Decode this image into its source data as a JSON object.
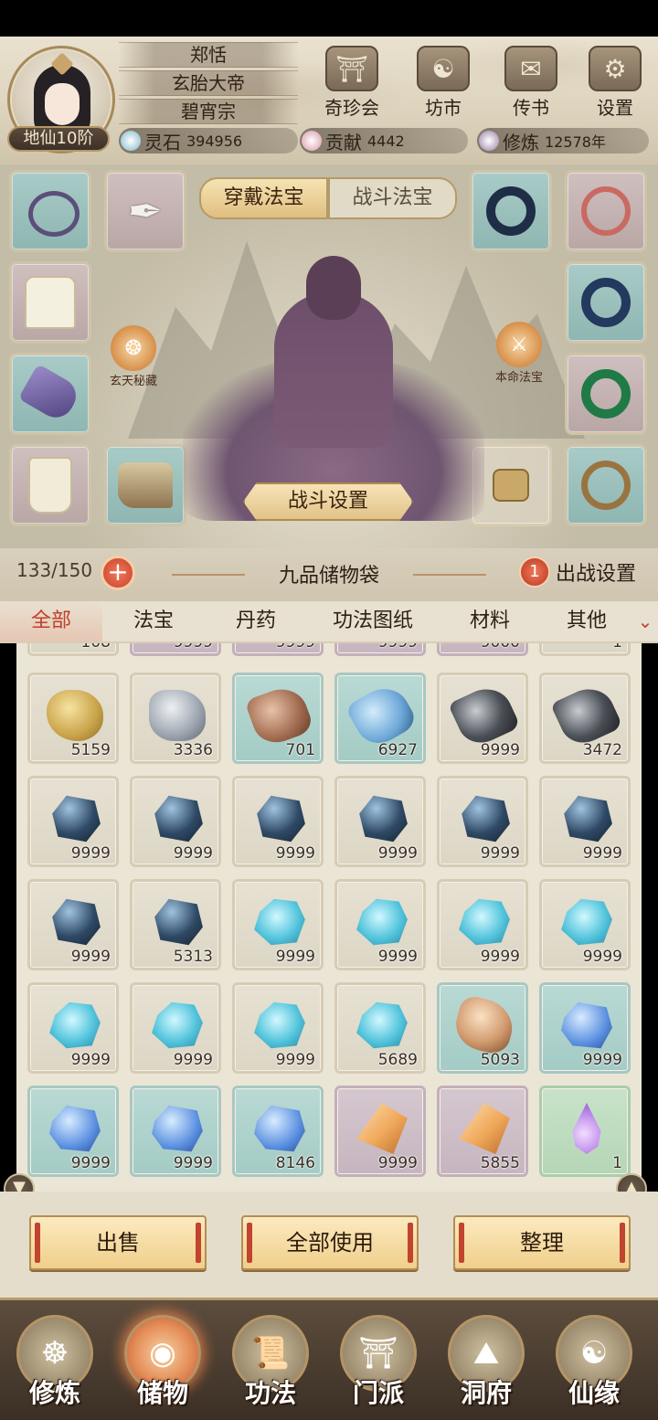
{
  "player": {
    "name": "郑恬",
    "title": "玄胎大帝",
    "sect": "碧宵宗",
    "rank": "地仙10阶"
  },
  "resources": [
    {
      "label": "灵石",
      "value": "394956",
      "icon": "spirit-stone-icon",
      "color": "#7fb7c9"
    },
    {
      "label": "贡献",
      "value": "4442",
      "icon": "contribution-icon",
      "color": "#d896a8"
    },
    {
      "label": "修炼",
      "value": "12578年",
      "icon": "cultivation-icon",
      "color": "#9a7ea6"
    }
  ],
  "top_buttons": [
    {
      "label": "奇珍会",
      "icon": "pavilion-icon",
      "glyph": "⛩"
    },
    {
      "label": "坊市",
      "icon": "market-icon",
      "glyph": "☯"
    },
    {
      "label": "传书",
      "icon": "scroll-icon",
      "glyph": "✉"
    },
    {
      "label": "设置",
      "icon": "gear-icon",
      "glyph": "⚙"
    }
  ],
  "equip_tabs": {
    "active": "穿戴法宝",
    "inactive": "战斗法宝"
  },
  "side_badges": {
    "left": "玄天秘藏",
    "right": "本命法宝"
  },
  "battle_settings": "战斗设置",
  "bag": {
    "capacity": "133/150",
    "title": "九品储物袋",
    "sortie_count": "1",
    "sortie_label": "出战设置"
  },
  "categories": [
    "全部",
    "法宝",
    "丹药",
    "功法图纸",
    "材料",
    "其他"
  ],
  "partial_row_counts": [
    "108",
    "9999",
    "9999",
    "9999",
    "9000",
    "1"
  ],
  "items": [
    {
      "count": "5159",
      "bg": "g",
      "kind": "gold-ore"
    },
    {
      "count": "3336",
      "bg": "g",
      "kind": "silver-ore"
    },
    {
      "count": "701",
      "bg": "t",
      "kind": "copper-ore"
    },
    {
      "count": "6927",
      "bg": "t",
      "kind": "blue-ore"
    },
    {
      "count": "9999",
      "bg": "g",
      "kind": "dark-ore"
    },
    {
      "count": "3472",
      "bg": "g",
      "kind": "dark-ore"
    },
    {
      "count": "9999",
      "bg": "g",
      "kind": "black-crystal"
    },
    {
      "count": "9999",
      "bg": "g",
      "kind": "black-crystal"
    },
    {
      "count": "9999",
      "bg": "g",
      "kind": "black-crystal"
    },
    {
      "count": "9999",
      "bg": "g",
      "kind": "black-crystal"
    },
    {
      "count": "9999",
      "bg": "g",
      "kind": "black-crystal"
    },
    {
      "count": "9999",
      "bg": "g",
      "kind": "black-crystal"
    },
    {
      "count": "9999",
      "bg": "g",
      "kind": "black-crystal"
    },
    {
      "count": "5313",
      "bg": "g",
      "kind": "black-crystal"
    },
    {
      "count": "9999",
      "bg": "g",
      "kind": "cyan-crystal"
    },
    {
      "count": "9999",
      "bg": "g",
      "kind": "cyan-crystal"
    },
    {
      "count": "9999",
      "bg": "g",
      "kind": "cyan-crystal"
    },
    {
      "count": "9999",
      "bg": "g",
      "kind": "cyan-crystal"
    },
    {
      "count": "9999",
      "bg": "g",
      "kind": "cyan-crystal"
    },
    {
      "count": "9999",
      "bg": "g",
      "kind": "cyan-crystal"
    },
    {
      "count": "9999",
      "bg": "g",
      "kind": "cyan-crystal"
    },
    {
      "count": "5689",
      "bg": "g",
      "kind": "cyan-crystal"
    },
    {
      "count": "5093",
      "bg": "t",
      "kind": "amber-stone"
    },
    {
      "count": "9999",
      "bg": "t",
      "kind": "blue-crystal"
    },
    {
      "count": "9999",
      "bg": "t",
      "kind": "blue-crystal"
    },
    {
      "count": "9999",
      "bg": "t",
      "kind": "blue-crystal"
    },
    {
      "count": "8146",
      "bg": "t",
      "kind": "blue-crystal"
    },
    {
      "count": "9999",
      "bg": "p",
      "kind": "orange-shard"
    },
    {
      "count": "5855",
      "bg": "p",
      "kind": "orange-shard"
    },
    {
      "count": "1",
      "bg": "gr",
      "kind": "purple-drop"
    }
  ],
  "actions": [
    "出售",
    "全部使用",
    "整理"
  ],
  "nav": [
    {
      "label": "修炼",
      "icon": "cultivate-icon",
      "glyph": "☸"
    },
    {
      "label": "储物",
      "icon": "storage-bag-icon",
      "glyph": "◉"
    },
    {
      "label": "功法",
      "icon": "technique-scroll-icon",
      "glyph": "📜"
    },
    {
      "label": "门派",
      "icon": "sect-gate-icon",
      "glyph": "⛩"
    },
    {
      "label": "洞府",
      "icon": "cave-abode-icon",
      "glyph": "⛰"
    },
    {
      "label": "仙缘",
      "icon": "immortal-fate-icon",
      "glyph": "☯"
    }
  ],
  "nav_active": 1
}
